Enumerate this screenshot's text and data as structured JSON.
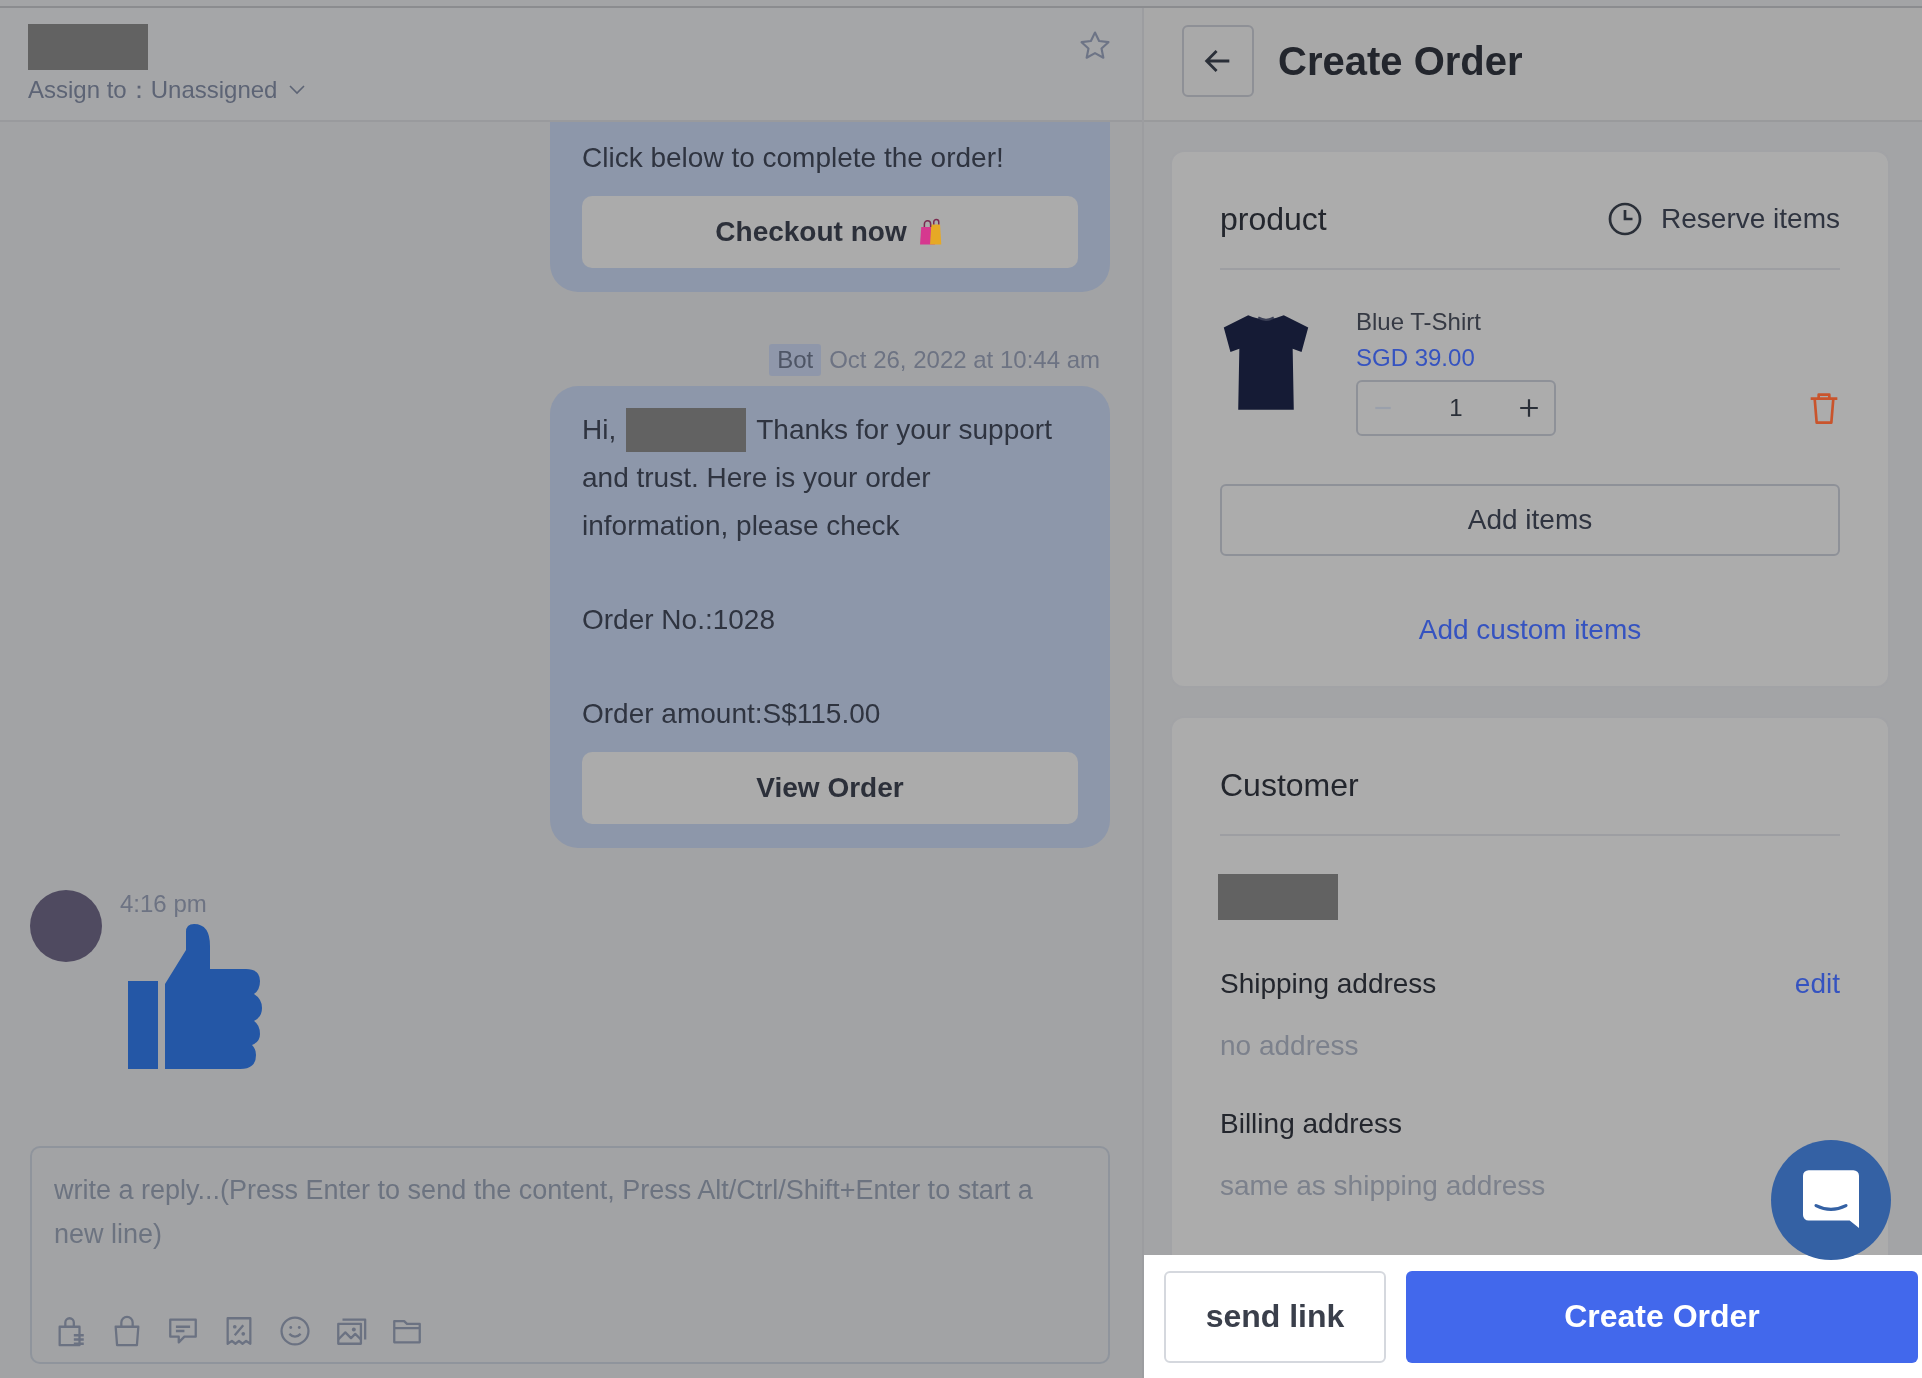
{
  "chat_header": {
    "contact": {
      "kind": "redacted"
    },
    "assign": "Assign to：Unassigned"
  },
  "messages": [
    {
      "kind": "bot_card",
      "paragraphs": [
        [
          [
            {
              "kind": "text",
              "text": "Click below to complete the order!"
            }
          ]
        ]
      ],
      "button": "Checkout now"
    },
    {
      "kind": "bot_card",
      "sender": "Bot",
      "time": "Oct 26, 2022 at 10:44 am",
      "paragraphs": [
        [
          [
            {
              "kind": "text",
              "text": "Hi,"
            },
            {
              "kind": "redacted"
            },
            {
              "kind": "text",
              "text": "Thanks for your support"
            }
          ],
          [
            {
              "kind": "text",
              "text": "and trust. Here is your order information, please check"
            }
          ]
        ],
        [
          [
            {
              "kind": "text",
              "text": "Order No.:1028"
            }
          ]
        ],
        [
          [
            {
              "kind": "text",
              "text": "Order amount:S$115.00"
            }
          ]
        ]
      ],
      "button": "View Order"
    },
    {
      "kind": "sticker",
      "time": "4:16 pm"
    }
  ],
  "reply": {
    "placeholder": "write a reply...(Press Enter to send the content, Press Alt/Ctrl/Shift+Enter to start a new line)"
  },
  "panel": {
    "title": "Create Order",
    "product": {
      "title": "product",
      "reserve": "Reserve items",
      "items": [
        {
          "name": "Blue T-Shirt",
          "price": "SGD 39.00",
          "quantity": "1",
          "minus_disabled": true
        }
      ],
      "add_items": "Add items",
      "add_custom": "Add custom items"
    },
    "customer": {
      "title": "Customer",
      "name": {
        "kind": "redacted"
      },
      "shipping_label": "Shipping address",
      "edit": "edit",
      "shipping_value": "no address",
      "billing_label": "Billing address",
      "billing_value": "same as shipping address"
    },
    "footer": {
      "secondary": "send link",
      "primary": "Create Order"
    }
  }
}
